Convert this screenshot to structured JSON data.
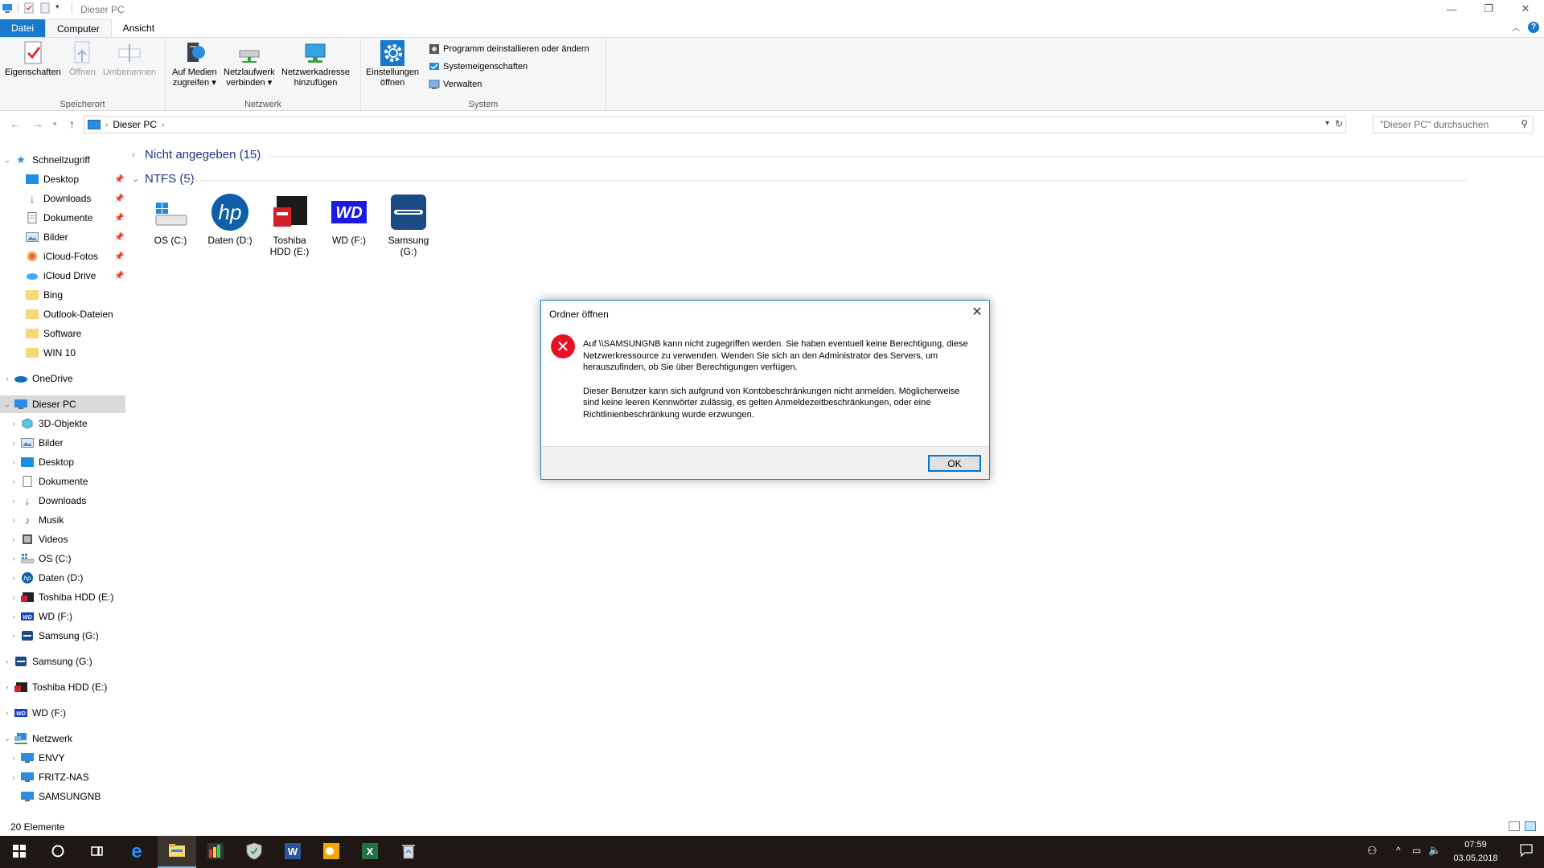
{
  "window": {
    "title": "Dieser PC"
  },
  "tabs": {
    "file": "Datei",
    "computer": "Computer",
    "view": "Ansicht"
  },
  "ribbon": {
    "properties": "Eigenschaften",
    "open": "Öffnen",
    "rename": "Umbenennen",
    "group_location": "Speicherort",
    "media_line1": "Auf Medien",
    "media_line2": "zugreifen",
    "netdrive_line1": "Netzlaufwerk",
    "netdrive_line2": "verbinden",
    "netaddr_line1": "Netzwerkadresse",
    "netaddr_line2": "hinzufügen",
    "group_network": "Netzwerk",
    "settings_line1": "Einstellungen",
    "settings_line2": "öffnen",
    "uninstall": "Programm deinstallieren oder ändern",
    "sysprops": "Systemeigenschaften",
    "manage": "Verwalten",
    "group_system": "System"
  },
  "address": {
    "crumb": "Dieser PC",
    "search_placeholder": "\"Dieser PC\" durchsuchen"
  },
  "nav": {
    "quick_access": "Schnellzugriff",
    "qa_items": [
      "Desktop",
      "Downloads",
      "Dokumente",
      "Bilder",
      "iCloud-Fotos",
      "iCloud Drive",
      "Bing",
      "Outlook-Dateien",
      "Software",
      "WIN 10"
    ],
    "onedrive": "OneDrive",
    "this_pc": "Dieser PC",
    "pc_items": [
      "3D-Objekte",
      "Bilder",
      "Desktop",
      "Dokumente",
      "Downloads",
      "Musik",
      "Videos",
      "OS (C:)",
      "Daten (D:)",
      "Toshiba HDD (E:)",
      "WD (F:)",
      "Samsung (G:)"
    ],
    "samsung": "Samsung (G:)",
    "toshiba": "Toshiba HDD (E:)",
    "wd": "WD (F:)",
    "network": "Netzwerk",
    "net_items": [
      "ENVY",
      "FRITZ-NAS",
      "SAMSUNGNB"
    ]
  },
  "content": {
    "group_unspecified": "Nicht angegeben (15)",
    "group_ntfs": "NTFS (5)",
    "drives": [
      {
        "label1": "OS (C:)",
        "label2": ""
      },
      {
        "label1": "Daten (D:)",
        "label2": ""
      },
      {
        "label1": "Toshiba",
        "label2": "HDD (E:)"
      },
      {
        "label1": "WD (F:)",
        "label2": ""
      },
      {
        "label1": "Samsung",
        "label2": "(G:)"
      }
    ]
  },
  "status": {
    "count": "20 Elemente"
  },
  "dialog": {
    "title": "Ordner öffnen",
    "msg1": "Auf \\\\SAMSUNGNB kann nicht zugegriffen werden. Sie haben eventuell keine Berechtigung, diese Netzwerkressource zu verwenden. Wenden Sie sich an den Administrator des Servers, um herauszufinden, ob Sie über Berechtigungen verfügen.",
    "msg2": "Dieser Benutzer kann sich aufgrund von Kontobeschränkungen nicht anmelden. Möglicherweise sind keine leeren Kennwörter zulässig, es gelten Anmeldezeitbeschränkungen, oder eine Richtlinienbeschränkung wurde erzwungen.",
    "ok": "OK"
  },
  "clock": {
    "time": "07:59",
    "date": "03.05.2018"
  },
  "colors": {
    "accent": "#1979ca",
    "error": "#e81123",
    "taskbar": "#1f1713",
    "group_header": "#1e3287"
  }
}
